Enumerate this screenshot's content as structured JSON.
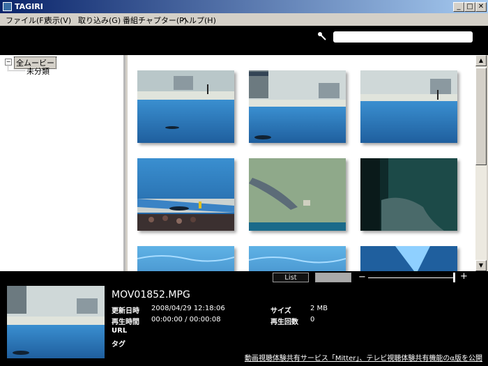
{
  "window": {
    "title": "TAGIRI",
    "minimize": "_",
    "maximize": "□",
    "close": "✕"
  },
  "menu": [
    "ファイル(F)",
    "表示(V)",
    "取り込み(G)",
    "番組チャプター(P)",
    "ヘルプ(H)"
  ],
  "search": {
    "placeholder": "",
    "value": ""
  },
  "tree": {
    "expander": "−",
    "root": "全ムービー",
    "child": "未分類"
  },
  "thumbnails": [
    {
      "scene": "pool-stage"
    },
    {
      "scene": "pool-stage"
    },
    {
      "scene": "pool-stage"
    },
    {
      "scene": "pool-crowd"
    },
    {
      "scene": "dolphin-close"
    },
    {
      "scene": "tank-dark"
    },
    {
      "scene": "water"
    },
    {
      "scene": "water"
    },
    {
      "scene": "water-dark"
    }
  ],
  "view": {
    "list_label": "List",
    "grid_label": "",
    "zoom_minus": "−",
    "zoom_plus": "+",
    "zoom_level": 1.0
  },
  "details": {
    "filename": "MOV01852.MPG",
    "updated_label": "更新日時",
    "updated_value": "2008/04/29 12:18:06",
    "playtime_label": "再生時間",
    "playtime_value": "00:00:00 / 00:00:08",
    "url_label": "URL",
    "tag_label": "タグ",
    "size_label": "サイズ",
    "size_value": "2 MB",
    "playcount_label": "再生回数",
    "playcount_value": "0"
  },
  "footer_link": "動画視聴体験共有サービス「Mitter」、テレビ視聴体験共有機能のα版を公開",
  "colors": {
    "titlebar_start": "#0a246a",
    "titlebar_end": "#a6caf0",
    "toolbar": "#000000",
    "pool_water": "#2a78b8"
  }
}
